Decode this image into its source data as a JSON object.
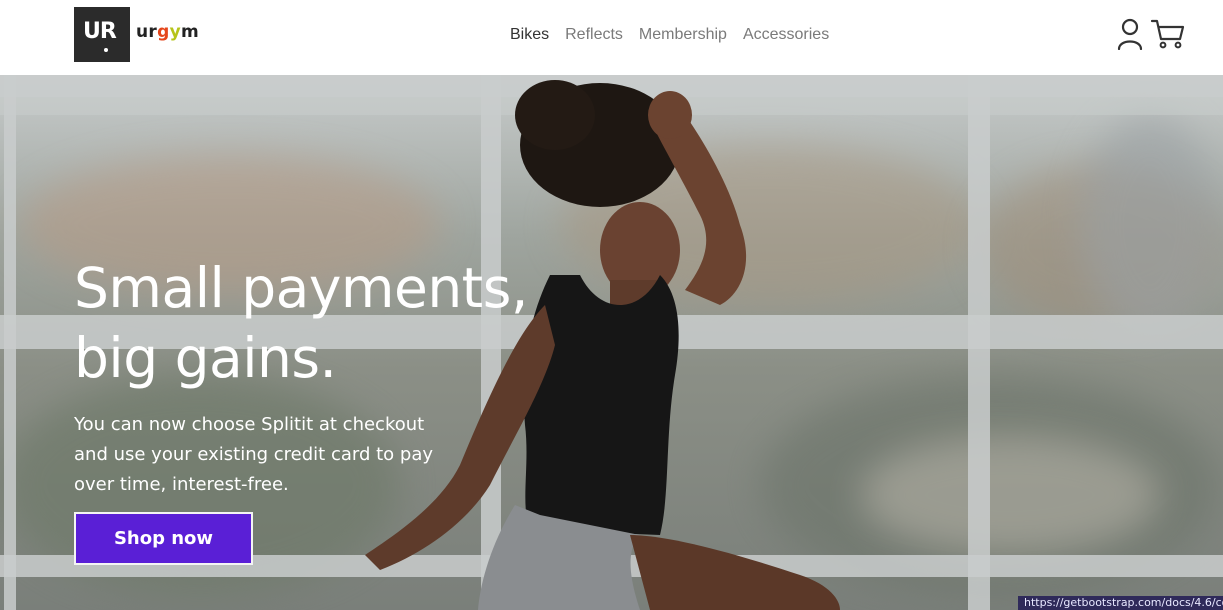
{
  "brand": {
    "logo_mark": "UR",
    "name_parts": [
      "ur",
      "g",
      "y",
      "m"
    ]
  },
  "nav": {
    "items": [
      {
        "label": "Bikes",
        "active": true
      },
      {
        "label": "Reflects",
        "active": false
      },
      {
        "label": "Membership",
        "active": false
      },
      {
        "label": "Accessories",
        "active": false
      }
    ]
  },
  "header_icons": {
    "account": "user-icon",
    "cart": "cart-icon"
  },
  "hero": {
    "title_line1": "Small payments,",
    "title_line2": "big gains.",
    "subtitle": "You can now choose Splitit at checkout and use your existing credit card to pay over time, interest-free.",
    "cta_label": "Shop now"
  },
  "status_bar": {
    "url": "https://getbootstrap.com/docs/4.6/co"
  },
  "colors": {
    "cta_background": "#5a1fd6",
    "logo_background": "#2b2b2b",
    "brand_g": "#e5461b",
    "brand_y": "#b6c41a",
    "nav_active": "#333333",
    "nav_inactive": "#7a7a7a"
  }
}
